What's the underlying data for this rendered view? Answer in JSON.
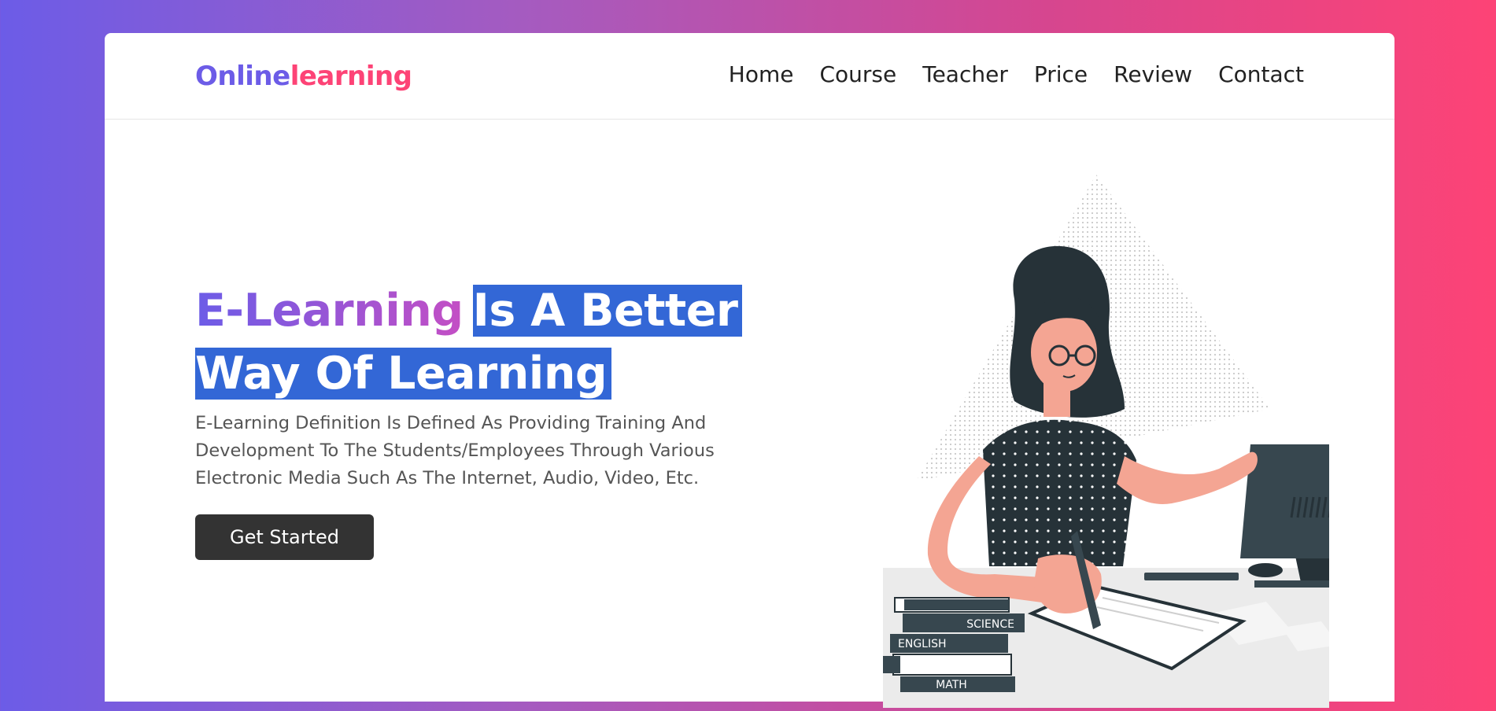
{
  "brand": {
    "part1": "Online",
    "part2": "learning"
  },
  "nav": [
    "Home",
    "Course",
    "Teacher",
    "Price",
    "Review",
    "Contact"
  ],
  "hero": {
    "title_gradient": "E-Learning",
    "title_highlight1": "Is A Better",
    "title_highlight2": "Way Of Learning",
    "description": "E-Learning Definition Is Defined As Providing Training And Development To The Students/Employees Through Various Electronic Media Such As The Internet, Audio, Video, Etc.",
    "cta": "Get Started"
  },
  "illustration": {
    "books": [
      "SCIENCE",
      "ENGLISH",
      "MATH"
    ]
  },
  "colors": {
    "gradient_start": "#6c5ce7",
    "gradient_end": "#fd4376",
    "highlight": "#3367d6",
    "button": "#333333"
  }
}
